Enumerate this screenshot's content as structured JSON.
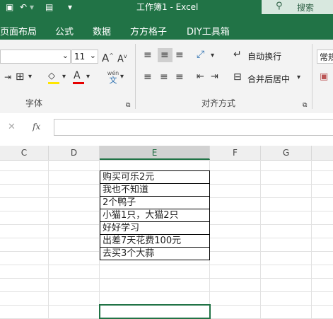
{
  "app": {
    "window_title": "工作簿1 - Excel",
    "search_label": "搜索",
    "accent_color": "#217346"
  },
  "menu": {
    "tabs": [
      "页面布局",
      "公式",
      "数据",
      "方方格子",
      "DIY工具箱"
    ]
  },
  "ribbon": {
    "font_size": "11",
    "wen_top": "wén",
    "wen_bottom": "文",
    "wrap_text": "自动换行",
    "merge_center": "合并后居中",
    "number_format": "常规",
    "group_font": "字体",
    "group_alignment": "对齐方式"
  },
  "formula_bar": {
    "fx_label": "fx",
    "content": ""
  },
  "sheet": {
    "columns": [
      "C",
      "D",
      "E",
      "F",
      "G"
    ],
    "selected_column": "E",
    "cells": [
      "购买可乐2元",
      "我也不知道",
      "2个鸭子",
      "小猫1只，大猫2只",
      "好好学习",
      "出差7天花费100元",
      "去买3个大蒜"
    ]
  }
}
